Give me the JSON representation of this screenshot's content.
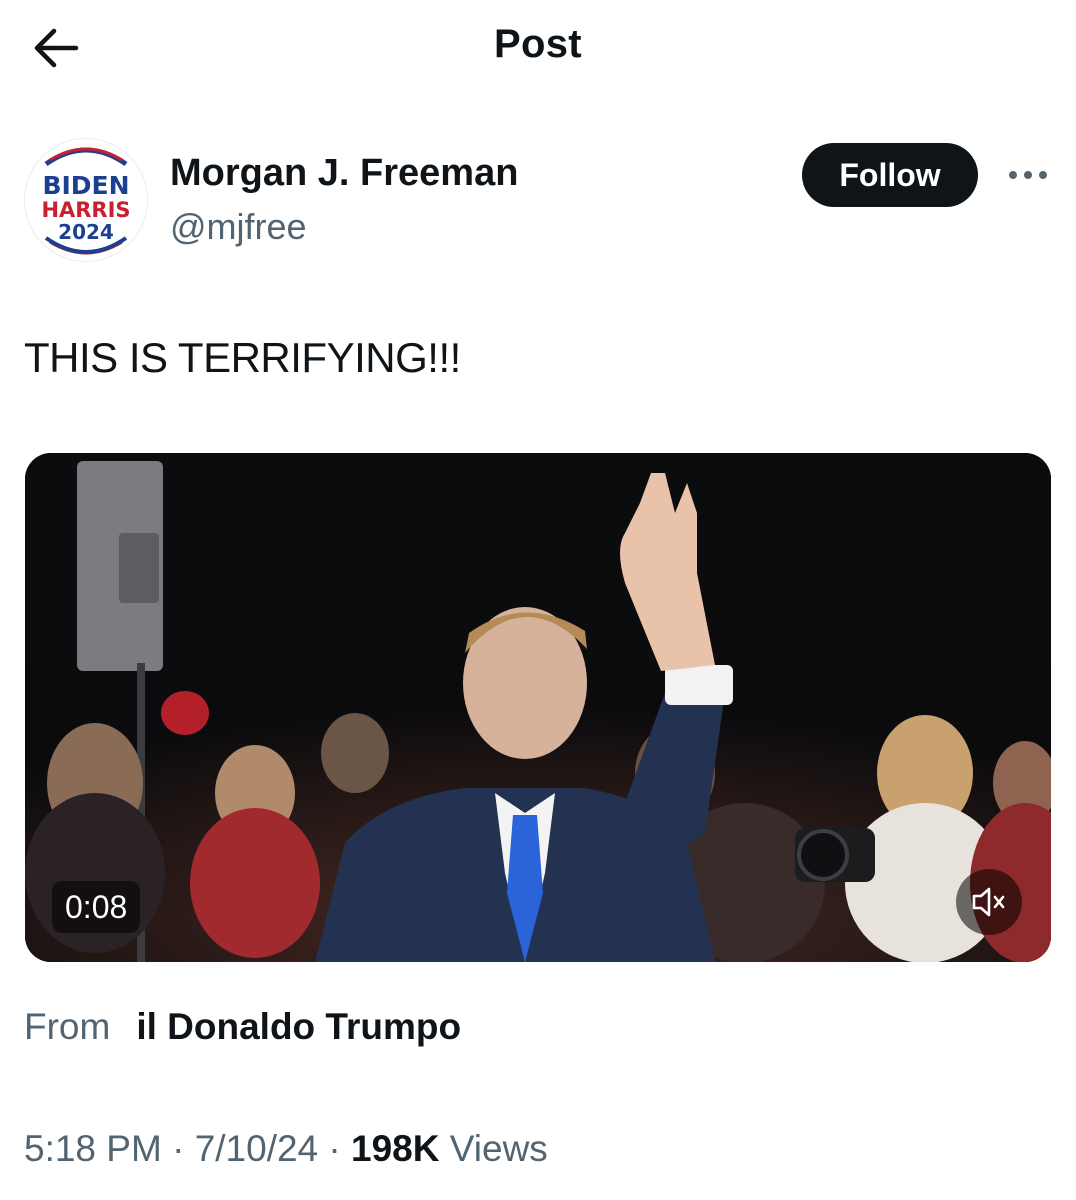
{
  "header": {
    "title": "Post",
    "back_icon": "arrow-left-icon"
  },
  "author": {
    "name": "Morgan J. Freeman",
    "handle": "@mjfree",
    "avatar": {
      "line1": "BIDEN",
      "line2": "HARRIS",
      "line3": "2024",
      "colors": {
        "blue": "#1d3f8f",
        "red": "#c8202f"
      }
    },
    "follow_label": "Follow",
    "more_icon": "more-horizontal-icon"
  },
  "post": {
    "text": "THIS IS TERRIFYING!!!"
  },
  "video": {
    "duration": "0:08",
    "mute_icon": "muted-speaker-icon"
  },
  "source": {
    "label": "From",
    "name": "il Donaldo Trumpo"
  },
  "meta": {
    "time": "5:18 PM",
    "date": "7/10/24",
    "separator": "·",
    "views_count": "198K",
    "views_label": "Views"
  },
  "colors": {
    "text_primary": "#0f1419",
    "text_secondary": "#536471",
    "follow_bg": "#0f1419"
  }
}
